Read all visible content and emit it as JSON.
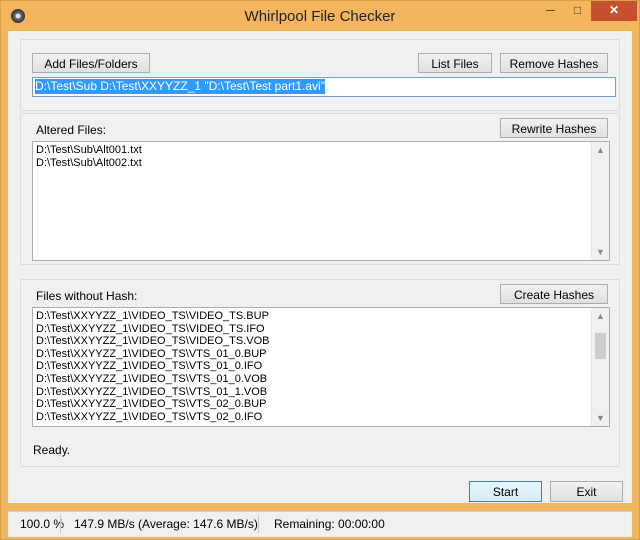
{
  "window": {
    "title": "Whirlpool File Checker",
    "min": "─",
    "max": "□",
    "close": "✕"
  },
  "top": {
    "add_button": "Add Files/Folders",
    "list_button": "List Files",
    "remove_button": "Remove Hashes",
    "path_value": "D:\\Test\\Sub D:\\Test\\XXYYZZ_1 \"D:\\Test\\Test part1.avi\""
  },
  "altered": {
    "label": "Altered Files:",
    "button": "Rewrite Hashes",
    "files": [
      "D:\\Test\\Sub\\Alt001.txt",
      "D:\\Test\\Sub\\Alt002.txt"
    ]
  },
  "nohash": {
    "label": "Files without Hash:",
    "button": "Create Hashes",
    "files": [
      "D:\\Test\\XXYYZZ_1\\VIDEO_TS\\VIDEO_TS.BUP",
      "D:\\Test\\XXYYZZ_1\\VIDEO_TS\\VIDEO_TS.IFO",
      "D:\\Test\\XXYYZZ_1\\VIDEO_TS\\VIDEO_TS.VOB",
      "D:\\Test\\XXYYZZ_1\\VIDEO_TS\\VTS_01_0.BUP",
      "D:\\Test\\XXYYZZ_1\\VIDEO_TS\\VTS_01_0.IFO",
      "D:\\Test\\XXYYZZ_1\\VIDEO_TS\\VTS_01_0.VOB",
      "D:\\Test\\XXYYZZ_1\\VIDEO_TS\\VTS_01_1.VOB",
      "D:\\Test\\XXYYZZ_1\\VIDEO_TS\\VTS_02_0.BUP",
      "D:\\Test\\XXYYZZ_1\\VIDEO_TS\\VTS_02_0.IFO"
    ],
    "scroll_fraction": 0.12
  },
  "status": {
    "text": "Ready."
  },
  "footer": {
    "start": "Start",
    "exit": "Exit"
  },
  "statusbar": {
    "percent": "100.0 %",
    "speed": "147.9 MB/s  (Average: 147.6 MB/s)",
    "remaining": "Remaining: 00:00:00"
  },
  "icons": {
    "scroll_up": "scroll-up-arrow-icon",
    "scroll_down": "scroll-down-arrow-icon",
    "app": "app-icon"
  }
}
